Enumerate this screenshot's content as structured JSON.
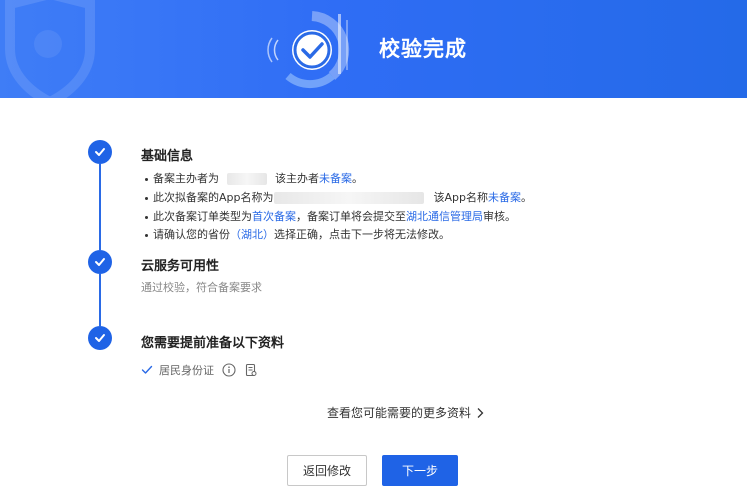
{
  "banner": {
    "title": "校验完成"
  },
  "steps": [
    {
      "title": "基础信息",
      "bullets": [
        {
          "prefix": "备案主办者为",
          "middle": "该主办者",
          "link": "未备案",
          "suffix": "。"
        },
        {
          "prefix": "此次拟备案的App名称为",
          "middle": "该App名称",
          "link": "未备案",
          "suffix": "。"
        },
        {
          "prefix": "此次备案订单类型为",
          "link1": "首次备案",
          "middle": "，备案订单将会提交至",
          "link2": "湖北通信管理局",
          "suffix": "审核。"
        },
        {
          "prefix": "请确认您的省份",
          "link": "（湖北）",
          "suffix": "选择正确，点击下一步将无法修改。"
        }
      ]
    },
    {
      "title": "云服务可用性",
      "description": "通过校验，符合备案要求"
    },
    {
      "title": "您需要提前准备以下资料",
      "documents": [
        {
          "label": "居民身份证"
        }
      ]
    }
  ],
  "more_link": {
    "label": "查看您可能需要的更多资料"
  },
  "buttons": {
    "back": "返回修改",
    "next": "下一步"
  },
  "colors": {
    "primary": "#1f63e6",
    "link": "#2a6ae6",
    "banner": "#2f6df5"
  }
}
